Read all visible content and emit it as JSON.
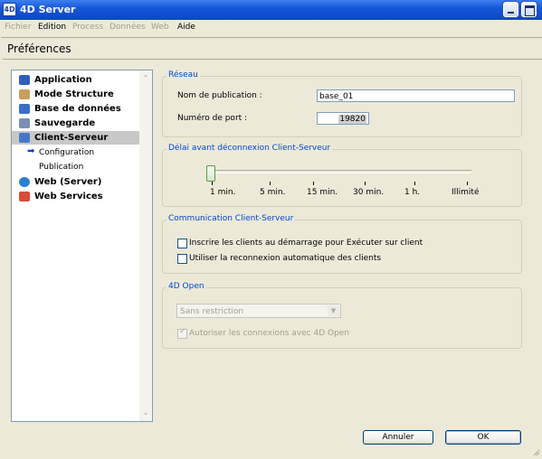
{
  "window": {
    "title": "4D Server"
  },
  "menubar": [
    {
      "label": "Fichier",
      "enabled": false
    },
    {
      "label": "Edition",
      "enabled": true
    },
    {
      "label": "Process",
      "enabled": false
    },
    {
      "label": "Données",
      "enabled": false
    },
    {
      "label": "Web",
      "enabled": false
    },
    {
      "label": "Aide",
      "enabled": true
    }
  ],
  "dialog": {
    "title": "Préférences"
  },
  "sidebar": {
    "items": [
      {
        "label": "Application",
        "icon": "application-icon"
      },
      {
        "label": "Mode Structure",
        "icon": "structure-icon"
      },
      {
        "label": "Base de données",
        "icon": "database-icon"
      },
      {
        "label": "Sauvegarde",
        "icon": "backup-icon"
      },
      {
        "label": "Client-Serveur",
        "icon": "client-server-icon",
        "selected": true
      },
      {
        "label": "Configuration",
        "sub": true,
        "current": true
      },
      {
        "label": "Publication",
        "sub": true
      },
      {
        "label": "Web (Server)",
        "icon": "globe-icon"
      },
      {
        "label": "Web Services",
        "icon": "web-services-icon"
      }
    ]
  },
  "network": {
    "legend": "Réseau",
    "publication_label": "Nom de publication :",
    "publication_value": "base_01",
    "port_label": "Numéro de port :",
    "port_value": "19820"
  },
  "timeout": {
    "legend": "Délai avant déconnexion Client-Serveur",
    "ticks": [
      "1 min.",
      "5 min.",
      "15 min.",
      "30 min.",
      "1 h.",
      "Illimité"
    ],
    "selected_index": 0
  },
  "communication": {
    "legend": "Communication Client-Serveur",
    "option1": "Inscrire les clients au démarrage pour Exécuter sur client",
    "option1_checked": false,
    "option2": "Utiliser la reconnexion automatique des clients",
    "option2_checked": false
  },
  "open4d": {
    "legend": "4D Open",
    "select_value": "Sans restriction",
    "checkbox_label": "Autoriser les connexions avec 4D Open",
    "checkbox_checked": true,
    "enabled": false
  },
  "buttons": {
    "cancel": "Annuler",
    "ok": "OK"
  },
  "colors": {
    "titlebar": "#0d45c5",
    "legend": "#0046d5",
    "dialog_bg": "#ece9d8"
  }
}
